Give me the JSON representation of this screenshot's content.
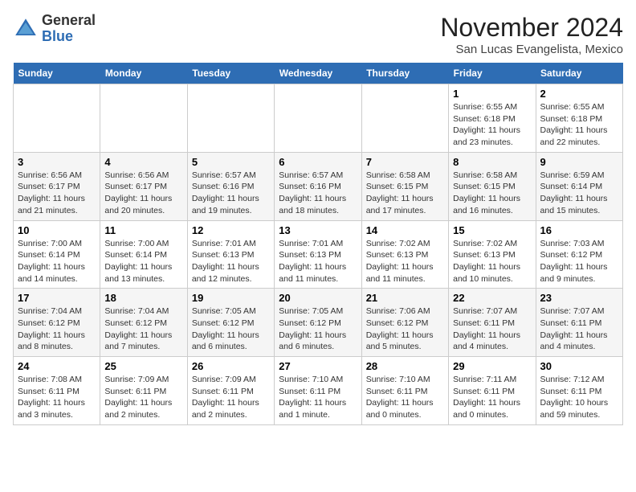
{
  "header": {
    "logo_general": "General",
    "logo_blue": "Blue",
    "month_title": "November 2024",
    "location": "San Lucas Evangelista, Mexico"
  },
  "weekdays": [
    "Sunday",
    "Monday",
    "Tuesday",
    "Wednesday",
    "Thursday",
    "Friday",
    "Saturday"
  ],
  "weeks": [
    [
      {
        "day": "",
        "info": ""
      },
      {
        "day": "",
        "info": ""
      },
      {
        "day": "",
        "info": ""
      },
      {
        "day": "",
        "info": ""
      },
      {
        "day": "",
        "info": ""
      },
      {
        "day": "1",
        "info": "Sunrise: 6:55 AM\nSunset: 6:18 PM\nDaylight: 11 hours and 23 minutes."
      },
      {
        "day": "2",
        "info": "Sunrise: 6:55 AM\nSunset: 6:18 PM\nDaylight: 11 hours and 22 minutes."
      }
    ],
    [
      {
        "day": "3",
        "info": "Sunrise: 6:56 AM\nSunset: 6:17 PM\nDaylight: 11 hours and 21 minutes."
      },
      {
        "day": "4",
        "info": "Sunrise: 6:56 AM\nSunset: 6:17 PM\nDaylight: 11 hours and 20 minutes."
      },
      {
        "day": "5",
        "info": "Sunrise: 6:57 AM\nSunset: 6:16 PM\nDaylight: 11 hours and 19 minutes."
      },
      {
        "day": "6",
        "info": "Sunrise: 6:57 AM\nSunset: 6:16 PM\nDaylight: 11 hours and 18 minutes."
      },
      {
        "day": "7",
        "info": "Sunrise: 6:58 AM\nSunset: 6:15 PM\nDaylight: 11 hours and 17 minutes."
      },
      {
        "day": "8",
        "info": "Sunrise: 6:58 AM\nSunset: 6:15 PM\nDaylight: 11 hours and 16 minutes."
      },
      {
        "day": "9",
        "info": "Sunrise: 6:59 AM\nSunset: 6:14 PM\nDaylight: 11 hours and 15 minutes."
      }
    ],
    [
      {
        "day": "10",
        "info": "Sunrise: 7:00 AM\nSunset: 6:14 PM\nDaylight: 11 hours and 14 minutes."
      },
      {
        "day": "11",
        "info": "Sunrise: 7:00 AM\nSunset: 6:14 PM\nDaylight: 11 hours and 13 minutes."
      },
      {
        "day": "12",
        "info": "Sunrise: 7:01 AM\nSunset: 6:13 PM\nDaylight: 11 hours and 12 minutes."
      },
      {
        "day": "13",
        "info": "Sunrise: 7:01 AM\nSunset: 6:13 PM\nDaylight: 11 hours and 11 minutes."
      },
      {
        "day": "14",
        "info": "Sunrise: 7:02 AM\nSunset: 6:13 PM\nDaylight: 11 hours and 11 minutes."
      },
      {
        "day": "15",
        "info": "Sunrise: 7:02 AM\nSunset: 6:13 PM\nDaylight: 11 hours and 10 minutes."
      },
      {
        "day": "16",
        "info": "Sunrise: 7:03 AM\nSunset: 6:12 PM\nDaylight: 11 hours and 9 minutes."
      }
    ],
    [
      {
        "day": "17",
        "info": "Sunrise: 7:04 AM\nSunset: 6:12 PM\nDaylight: 11 hours and 8 minutes."
      },
      {
        "day": "18",
        "info": "Sunrise: 7:04 AM\nSunset: 6:12 PM\nDaylight: 11 hours and 7 minutes."
      },
      {
        "day": "19",
        "info": "Sunrise: 7:05 AM\nSunset: 6:12 PM\nDaylight: 11 hours and 6 minutes."
      },
      {
        "day": "20",
        "info": "Sunrise: 7:05 AM\nSunset: 6:12 PM\nDaylight: 11 hours and 6 minutes."
      },
      {
        "day": "21",
        "info": "Sunrise: 7:06 AM\nSunset: 6:12 PM\nDaylight: 11 hours and 5 minutes."
      },
      {
        "day": "22",
        "info": "Sunrise: 7:07 AM\nSunset: 6:11 PM\nDaylight: 11 hours and 4 minutes."
      },
      {
        "day": "23",
        "info": "Sunrise: 7:07 AM\nSunset: 6:11 PM\nDaylight: 11 hours and 4 minutes."
      }
    ],
    [
      {
        "day": "24",
        "info": "Sunrise: 7:08 AM\nSunset: 6:11 PM\nDaylight: 11 hours and 3 minutes."
      },
      {
        "day": "25",
        "info": "Sunrise: 7:09 AM\nSunset: 6:11 PM\nDaylight: 11 hours and 2 minutes."
      },
      {
        "day": "26",
        "info": "Sunrise: 7:09 AM\nSunset: 6:11 PM\nDaylight: 11 hours and 2 minutes."
      },
      {
        "day": "27",
        "info": "Sunrise: 7:10 AM\nSunset: 6:11 PM\nDaylight: 11 hours and 1 minute."
      },
      {
        "day": "28",
        "info": "Sunrise: 7:10 AM\nSunset: 6:11 PM\nDaylight: 11 hours and 0 minutes."
      },
      {
        "day": "29",
        "info": "Sunrise: 7:11 AM\nSunset: 6:11 PM\nDaylight: 11 hours and 0 minutes."
      },
      {
        "day": "30",
        "info": "Sunrise: 7:12 AM\nSunset: 6:11 PM\nDaylight: 10 hours and 59 minutes."
      }
    ]
  ]
}
